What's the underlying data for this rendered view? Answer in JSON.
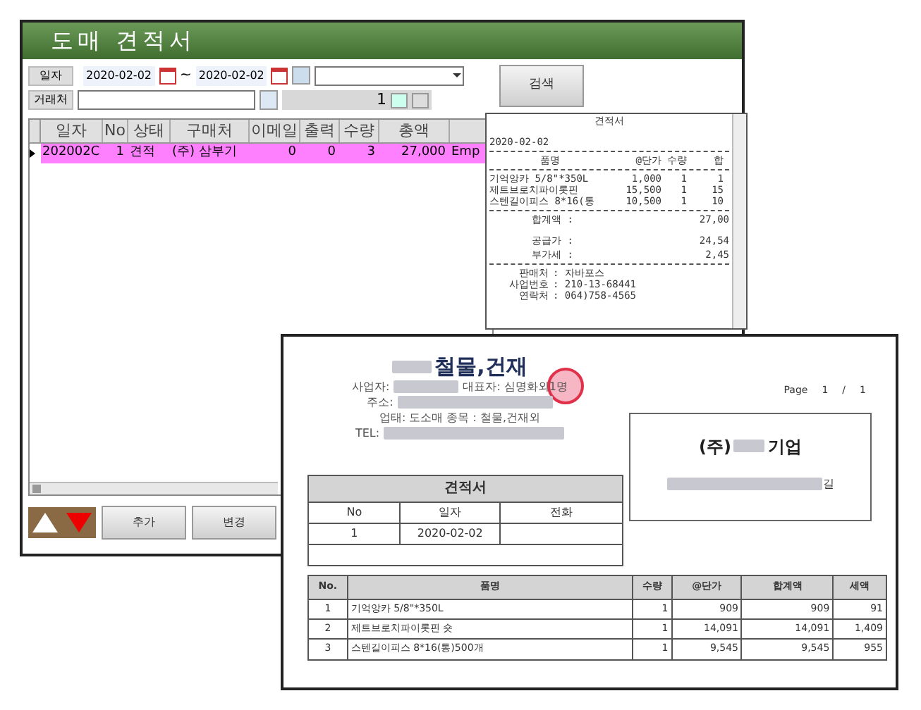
{
  "main_window": {
    "title": "도매 견적서",
    "filters": {
      "date_label": "일자",
      "date_from": "2020-02-02",
      "tilde": "~",
      "date_to": "2020-02-02",
      "partner_label": "거래처",
      "counter": "1"
    },
    "search_button": "검색",
    "grid": {
      "columns": [
        "일자",
        "No",
        "상태",
        "구매처",
        "이메일",
        "출력",
        "수량",
        "총액"
      ],
      "rows": [
        {
          "selected": true,
          "cells": [
            "202002C",
            "1",
            "견적",
            "(주) 삼부기",
            "0",
            "0",
            "3",
            "27,000",
            "Emp"
          ]
        }
      ]
    },
    "buttons": [
      "추가",
      "변경"
    ],
    "receipt": {
      "title": "견적서",
      "date": "2020-02-02",
      "header": [
        "품명",
        "@단가",
        "수량",
        "합"
      ],
      "items": [
        [
          "기억앙카 5/8\"*350L",
          "1,000",
          "1",
          "1"
        ],
        [
          "제트브로치파이롯핀",
          "15,500",
          "1",
          "15"
        ],
        [
          "스텐길이피스 8*16(통",
          "10,500",
          "1",
          "10"
        ]
      ],
      "totals": [
        {
          "label": "합계액 :",
          "value": "27,00"
        },
        {
          "label": "공급가 :",
          "value": "24,54"
        },
        {
          "label": "부가세 :",
          "value": "2,45"
        }
      ],
      "seller": [
        {
          "label": "판매처",
          "value": ": 자바포스"
        },
        {
          "label": "사업번호",
          "value": ": 210-13-68441"
        },
        {
          "label": "연락처",
          "value": ": 064)758-4565"
        }
      ]
    }
  },
  "preview": {
    "company": "철물,건재",
    "info_lines": [
      [
        {
          "kind": "text",
          "text": "사업자:"
        },
        {
          "kind": "redacted"
        },
        {
          "kind": "text",
          "text": "대표자: 심명화외1명"
        }
      ],
      [
        {
          "kind": "text",
          "text": "주소:"
        },
        {
          "kind": "redacted"
        }
      ],
      [
        {
          "kind": "text",
          "text": "업태: 도소매  종목 : 철물,건재외"
        }
      ],
      [
        {
          "kind": "text",
          "text": "TEL:"
        },
        {
          "kind": "redacted"
        }
      ]
    ],
    "page": [
      "Page",
      "1",
      "/",
      "1"
    ],
    "customer": {
      "prefix": "(주)",
      "suffix": "기업",
      "address_end": "길"
    },
    "doc_table": {
      "title": "견적서",
      "columns": [
        "No",
        "일자",
        "전화"
      ],
      "row": [
        "1",
        "2020-02-02"
      ]
    },
    "items_table": {
      "columns": [
        "No.",
        "품명",
        "수량",
        "@단가",
        "합계액",
        "세액"
      ],
      "rows": [
        [
          "1",
          "기억앙카 5/8\"*350L",
          "1",
          "909",
          "909",
          "91"
        ],
        [
          "2",
          "제트브로치파이롯핀 숏",
          "1",
          "14,091",
          "14,091",
          "1,409"
        ],
        [
          "3",
          "스텐길이피스 8*16(통)500개",
          "1",
          "9,545",
          "9,545",
          "955"
        ]
      ]
    }
  }
}
